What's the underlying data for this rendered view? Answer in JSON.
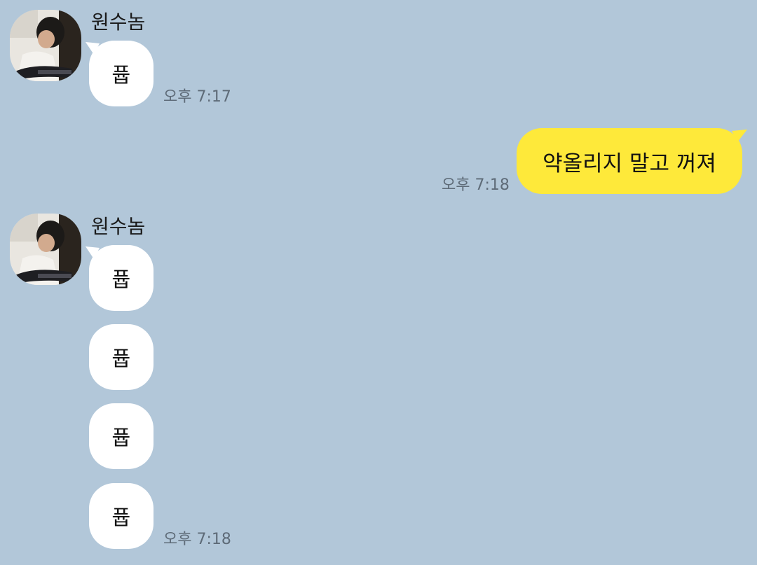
{
  "chat": {
    "groups": [
      {
        "sender": "원수놈",
        "messages": [
          "퓹"
        ],
        "time": "오후 7:17"
      },
      {
        "mine": true,
        "messages": [
          "약올리지 말고 꺼져"
        ],
        "time": "오후 7:18"
      },
      {
        "sender": "원수놈",
        "messages": [
          "퓹",
          "퓹",
          "퓹",
          "퓹"
        ],
        "time": "오후 7:18"
      }
    ]
  },
  "colors": {
    "background": "#b2c7d9",
    "incoming_bubble": "#ffffff",
    "outgoing_bubble": "#fee93a",
    "timestamp": "#5e6b78"
  }
}
